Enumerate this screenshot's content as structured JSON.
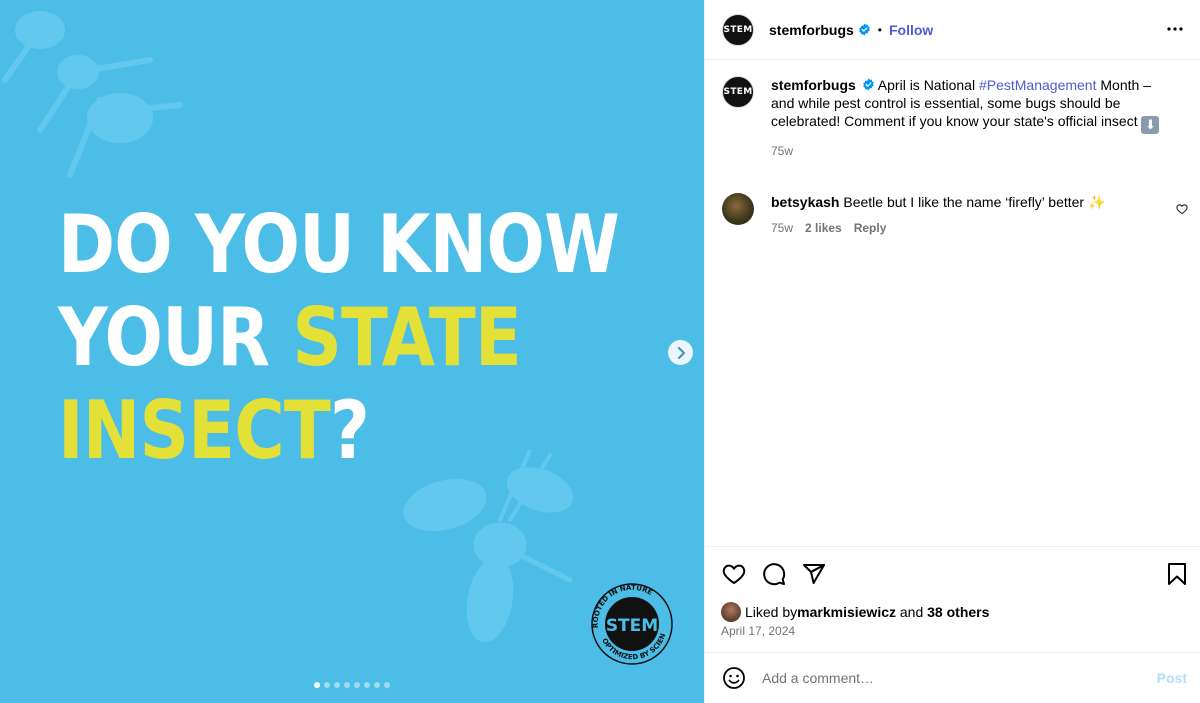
{
  "media": {
    "headline_line1": "DO YOU KNOW",
    "headline_line2_a": "YOUR ",
    "headline_line2_b": "STATE",
    "headline_line3_a": "INSECT",
    "headline_line3_b": "?",
    "badge_center": "STEM",
    "badge_ring_top": "ROOTED IN NATURE",
    "badge_ring_bottom": "OPTIMIZED BY SCIENCE",
    "carousel_total": 8,
    "carousel_active": 1,
    "colors": {
      "background": "#4cbde6",
      "white_text": "#ffffff",
      "highlight": "#e3e038"
    }
  },
  "header": {
    "avatar_text": "STEM",
    "username": "stemforbugs",
    "separator": "•",
    "follow_label": "Follow"
  },
  "caption": {
    "avatar_text": "STEM",
    "username": "stemforbugs",
    "text_before": " April is National ",
    "hashtag": "#PestManagement",
    "text_after": " Month – and while pest control is essential, some bugs should be celebrated! Comment if you know your state's official insect ",
    "emoji": "⬇",
    "time": "75w"
  },
  "comment": {
    "username": "betsykash",
    "text": " Beetle but I like the name ‘firefly’ better ",
    "emoji": "✨",
    "time": "75w",
    "likes": "2 likes",
    "reply_label": "Reply"
  },
  "footer": {
    "liked_prefix": "Liked by ",
    "liked_user": "markmisiewicz",
    "liked_and": " and ",
    "liked_others": "38 others",
    "date": "April 17, 2024"
  },
  "add_comment": {
    "placeholder": "Add a comment…",
    "post_label": "Post"
  },
  "colors": {
    "accent": "#4f5bd5",
    "verified": "#0095f6",
    "muted": "#737373",
    "post_disabled": "#b2dffc"
  }
}
